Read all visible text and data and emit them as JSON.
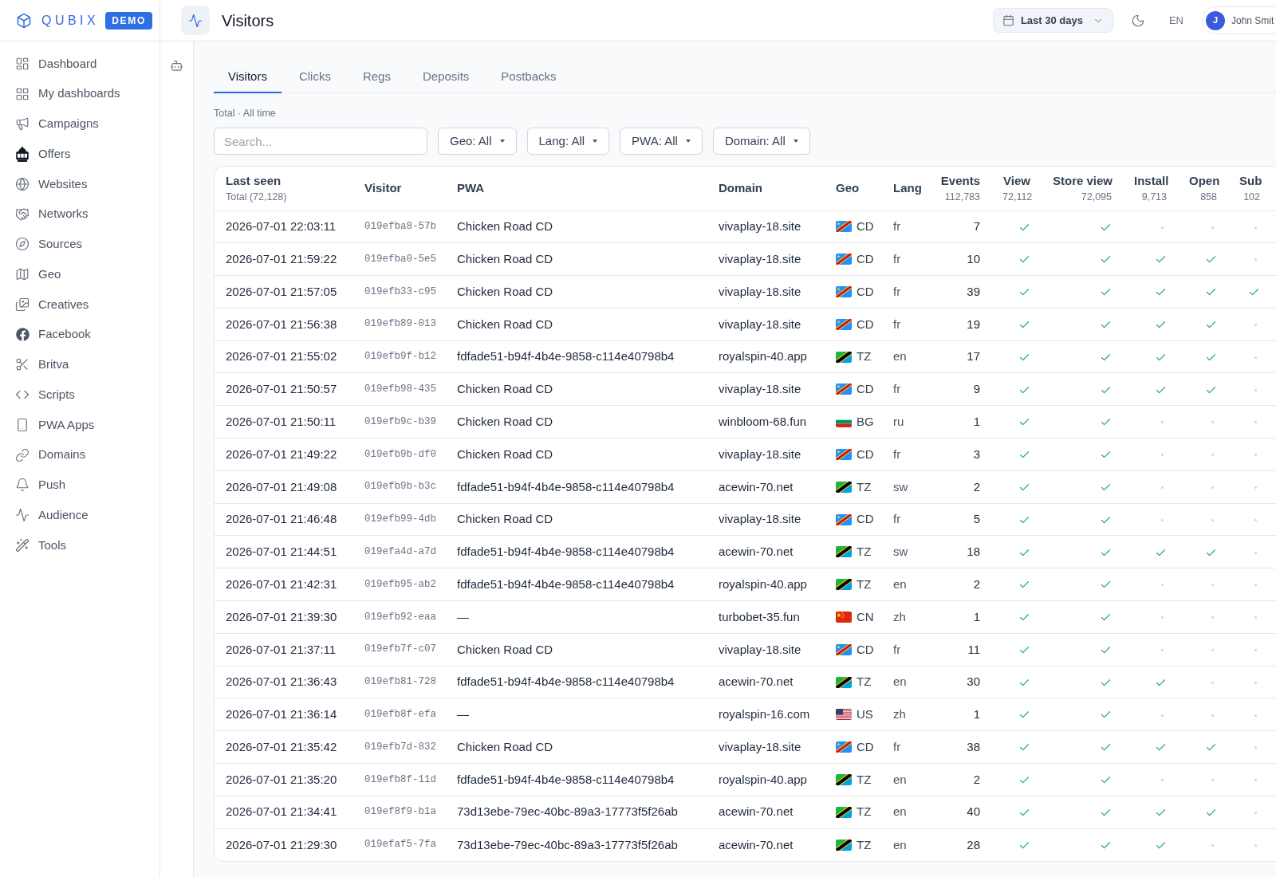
{
  "brand": {
    "name": "QUBIX",
    "badge": "DEMO"
  },
  "sidebar": {
    "items": [
      "Dashboard",
      "My dashboards",
      "Campaigns",
      "Offers",
      "Websites",
      "Networks",
      "Sources",
      "Geo",
      "Creatives",
      "Facebook",
      "Britva",
      "Scripts",
      "PWA Apps",
      "Domains",
      "Push",
      "Audience",
      "Tools"
    ]
  },
  "header": {
    "title": "Visitors",
    "date_range": "Last 30 days",
    "language": "EN",
    "user": {
      "initial": "J",
      "name": "John Smit"
    }
  },
  "tabs": [
    {
      "label": "Visitors",
      "selected": true
    },
    {
      "label": "Clicks",
      "selected": false
    },
    {
      "label": "Regs",
      "selected": false
    },
    {
      "label": "Deposits",
      "selected": false
    },
    {
      "label": "Postbacks",
      "selected": false
    }
  ],
  "summary": "Total · All time",
  "search": {
    "placeholder": "Search..."
  },
  "filters": [
    "Geo: All",
    "Lang: All",
    "PWA: All",
    "Domain: All"
  ],
  "table": {
    "columns": [
      {
        "label": "Last seen",
        "total": "Total (72,128)"
      },
      {
        "label": "Visitor"
      },
      {
        "label": "PWA"
      },
      {
        "label": "Domain"
      },
      {
        "label": "Geo"
      },
      {
        "label": "Lang"
      },
      {
        "label": "Events",
        "total": "112,783"
      },
      {
        "label": "View",
        "total": "72,112"
      },
      {
        "label": "Store view",
        "total": "72,095"
      },
      {
        "label": "Install",
        "total": "9,713"
      },
      {
        "label": "Open",
        "total": "858"
      },
      {
        "label": "Sub",
        "total": "102"
      }
    ],
    "rows": [
      {
        "last_seen": "2026-07-01 22:03:11",
        "visitor": "019efba8-57b",
        "pwa": "Chicken Road CD",
        "domain": "vivaplay-18.site",
        "flag": {
          "kind": "cd"
        },
        "geo": "CD",
        "lang": "fr",
        "events": "7",
        "view": true,
        "store_view": true,
        "install": false,
        "open": false,
        "sub": false
      },
      {
        "last_seen": "2026-07-01 21:59:22",
        "visitor": "019efba0-5e5",
        "pwa": "Chicken Road CD",
        "domain": "vivaplay-18.site",
        "flag": {
          "kind": "cd"
        },
        "geo": "CD",
        "lang": "fr",
        "events": "10",
        "view": true,
        "store_view": true,
        "install": true,
        "open": true,
        "sub": false
      },
      {
        "last_seen": "2026-07-01 21:57:05",
        "visitor": "019efb33-c95",
        "pwa": "Chicken Road CD",
        "domain": "vivaplay-18.site",
        "flag": {
          "kind": "cd"
        },
        "geo": "CD",
        "lang": "fr",
        "events": "39",
        "view": true,
        "store_view": true,
        "install": true,
        "open": true,
        "sub": true
      },
      {
        "last_seen": "2026-07-01 21:56:38",
        "visitor": "019efb89-013",
        "pwa": "Chicken Road CD",
        "domain": "vivaplay-18.site",
        "flag": {
          "kind": "cd"
        },
        "geo": "CD",
        "lang": "fr",
        "events": "19",
        "view": true,
        "store_view": true,
        "install": true,
        "open": true,
        "sub": false
      },
      {
        "last_seen": "2026-07-01 21:55:02",
        "visitor": "019efb9f-b12",
        "pwa": "fdfade51-b94f-4b4e-9858-c114e40798b4",
        "domain": "royalspin-40.app",
        "flag": {
          "kind": "tz"
        },
        "geo": "TZ",
        "lang": "en",
        "events": "17",
        "view": true,
        "store_view": true,
        "install": true,
        "open": true,
        "sub": false
      },
      {
        "last_seen": "2026-07-01 21:50:57",
        "visitor": "019efb98-435",
        "pwa": "Chicken Road CD",
        "domain": "vivaplay-18.site",
        "flag": {
          "kind": "cd"
        },
        "geo": "CD",
        "lang": "fr",
        "events": "9",
        "view": true,
        "store_view": true,
        "install": true,
        "open": true,
        "sub": false
      },
      {
        "last_seen": "2026-07-01 21:50:11",
        "visitor": "019efb9c-b39",
        "pwa": "Chicken Road CD",
        "domain": "winbloom-68.fun",
        "flag": {
          "kind": "bg"
        },
        "geo": "BG",
        "lang": "ru",
        "events": "1",
        "view": true,
        "store_view": true,
        "install": false,
        "open": false,
        "sub": false
      },
      {
        "last_seen": "2026-07-01 21:49:22",
        "visitor": "019efb9b-df0",
        "pwa": "Chicken Road CD",
        "domain": "vivaplay-18.site",
        "flag": {
          "kind": "cd"
        },
        "geo": "CD",
        "lang": "fr",
        "events": "3",
        "view": true,
        "store_view": true,
        "install": false,
        "open": false,
        "sub": false
      },
      {
        "last_seen": "2026-07-01 21:49:08",
        "visitor": "019efb9b-b3c",
        "pwa": "fdfade51-b94f-4b4e-9858-c114e40798b4",
        "domain": "acewin-70.net",
        "flag": {
          "kind": "tz"
        },
        "geo": "TZ",
        "lang": "sw",
        "events": "2",
        "view": true,
        "store_view": true,
        "install": false,
        "open": false,
        "sub": false
      },
      {
        "last_seen": "2026-07-01 21:46:48",
        "visitor": "019efb99-4db",
        "pwa": "Chicken Road CD",
        "domain": "vivaplay-18.site",
        "flag": {
          "kind": "cd"
        },
        "geo": "CD",
        "lang": "fr",
        "events": "5",
        "view": true,
        "store_view": true,
        "install": false,
        "open": false,
        "sub": false
      },
      {
        "last_seen": "2026-07-01 21:44:51",
        "visitor": "019efa4d-a7d",
        "pwa": "fdfade51-b94f-4b4e-9858-c114e40798b4",
        "domain": "acewin-70.net",
        "flag": {
          "kind": "tz"
        },
        "geo": "TZ",
        "lang": "sw",
        "events": "18",
        "view": true,
        "store_view": true,
        "install": true,
        "open": true,
        "sub": false
      },
      {
        "last_seen": "2026-07-01 21:42:31",
        "visitor": "019efb95-ab2",
        "pwa": "fdfade51-b94f-4b4e-9858-c114e40798b4",
        "domain": "royalspin-40.app",
        "flag": {
          "kind": "tz"
        },
        "geo": "TZ",
        "lang": "en",
        "events": "2",
        "view": true,
        "store_view": true,
        "install": false,
        "open": false,
        "sub": false
      },
      {
        "last_seen": "2026-07-01 21:39:30",
        "visitor": "019efb92-eaa",
        "pwa": "—",
        "domain": "turbobet-35.fun",
        "flag": {
          "kind": "cn"
        },
        "geo": "CN",
        "lang": "zh",
        "events": "1",
        "view": true,
        "store_view": true,
        "install": false,
        "open": false,
        "sub": false
      },
      {
        "last_seen": "2026-07-01 21:37:11",
        "visitor": "019efb7f-c07",
        "pwa": "Chicken Road CD",
        "domain": "vivaplay-18.site",
        "flag": {
          "kind": "cd"
        },
        "geo": "CD",
        "lang": "fr",
        "events": "11",
        "view": true,
        "store_view": true,
        "install": false,
        "open": false,
        "sub": false
      },
      {
        "last_seen": "2026-07-01 21:36:43",
        "visitor": "019efb81-728",
        "pwa": "fdfade51-b94f-4b4e-9858-c114e40798b4",
        "domain": "acewin-70.net",
        "flag": {
          "kind": "tz"
        },
        "geo": "TZ",
        "lang": "en",
        "events": "30",
        "view": true,
        "store_view": true,
        "install": true,
        "open": false,
        "sub": false
      },
      {
        "last_seen": "2026-07-01 21:36:14",
        "visitor": "019efb8f-efa",
        "pwa": "—",
        "domain": "royalspin-16.com",
        "flag": {
          "kind": "us"
        },
        "geo": "US",
        "lang": "zh",
        "events": "1",
        "view": true,
        "store_view": true,
        "install": false,
        "open": false,
        "sub": false
      },
      {
        "last_seen": "2026-07-01 21:35:42",
        "visitor": "019efb7d-832",
        "pwa": "Chicken Road CD",
        "domain": "vivaplay-18.site",
        "flag": {
          "kind": "cd"
        },
        "geo": "CD",
        "lang": "fr",
        "events": "38",
        "view": true,
        "store_view": true,
        "install": true,
        "open": true,
        "sub": false
      },
      {
        "last_seen": "2026-07-01 21:35:20",
        "visitor": "019efb8f-11d",
        "pwa": "fdfade51-b94f-4b4e-9858-c114e40798b4",
        "domain": "royalspin-40.app",
        "flag": {
          "kind": "tz"
        },
        "geo": "TZ",
        "lang": "en",
        "events": "2",
        "view": true,
        "store_view": true,
        "install": false,
        "open": false,
        "sub": false
      },
      {
        "last_seen": "2026-07-01 21:34:41",
        "visitor": "019ef8f9-b1a",
        "pwa": "73d13ebe-79ec-40bc-89a3-17773f5f26ab",
        "domain": "acewin-70.net",
        "flag": {
          "kind": "tz"
        },
        "geo": "TZ",
        "lang": "en",
        "events": "40",
        "view": true,
        "store_view": true,
        "install": true,
        "open": true,
        "sub": false
      },
      {
        "last_seen": "2026-07-01 21:29:30",
        "visitor": "019efaf5-7fa",
        "pwa": "73d13ebe-79ec-40bc-89a3-17773f5f26ab",
        "domain": "acewin-70.net",
        "flag": {
          "kind": "tz"
        },
        "geo": "TZ",
        "lang": "en",
        "events": "28",
        "view": true,
        "store_view": true,
        "install": true,
        "open": false,
        "sub": false
      }
    ]
  }
}
